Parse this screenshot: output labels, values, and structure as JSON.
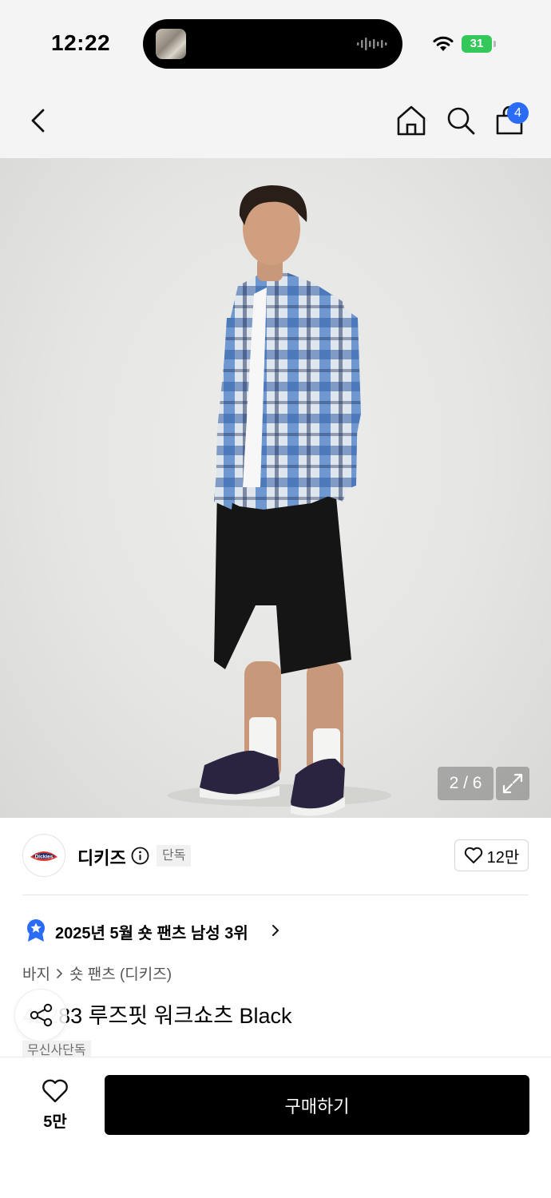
{
  "status_bar": {
    "time": "12:22",
    "battery": "31"
  },
  "nav": {
    "cart_count": "4",
    "icons": [
      "back-icon",
      "home-icon",
      "search-icon",
      "cart-icon"
    ]
  },
  "gallery": {
    "counter": "2 / 6"
  },
  "brand": {
    "name": "디키즈",
    "exclusive_label": "단독",
    "like_count": "12만",
    "logo_text": "Dickies"
  },
  "ranking": {
    "text": "2025년 5월 숏 팬츠 남성 3위"
  },
  "category": {
    "parent": "바지",
    "child": "숏 팬츠 (디키즈)"
  },
  "product": {
    "title": "42283 루즈핏 워크쇼츠 Black",
    "title_visible": "83 루즈핏 워크쇼츠 Black",
    "tag": "무신사단독"
  },
  "bottom_bar": {
    "wish_count": "5만",
    "buy_label": "구매하기"
  },
  "colors": {
    "badge_blue": "#2b6cf6",
    "battery_green": "#34c759",
    "buy_button": "#000000"
  }
}
